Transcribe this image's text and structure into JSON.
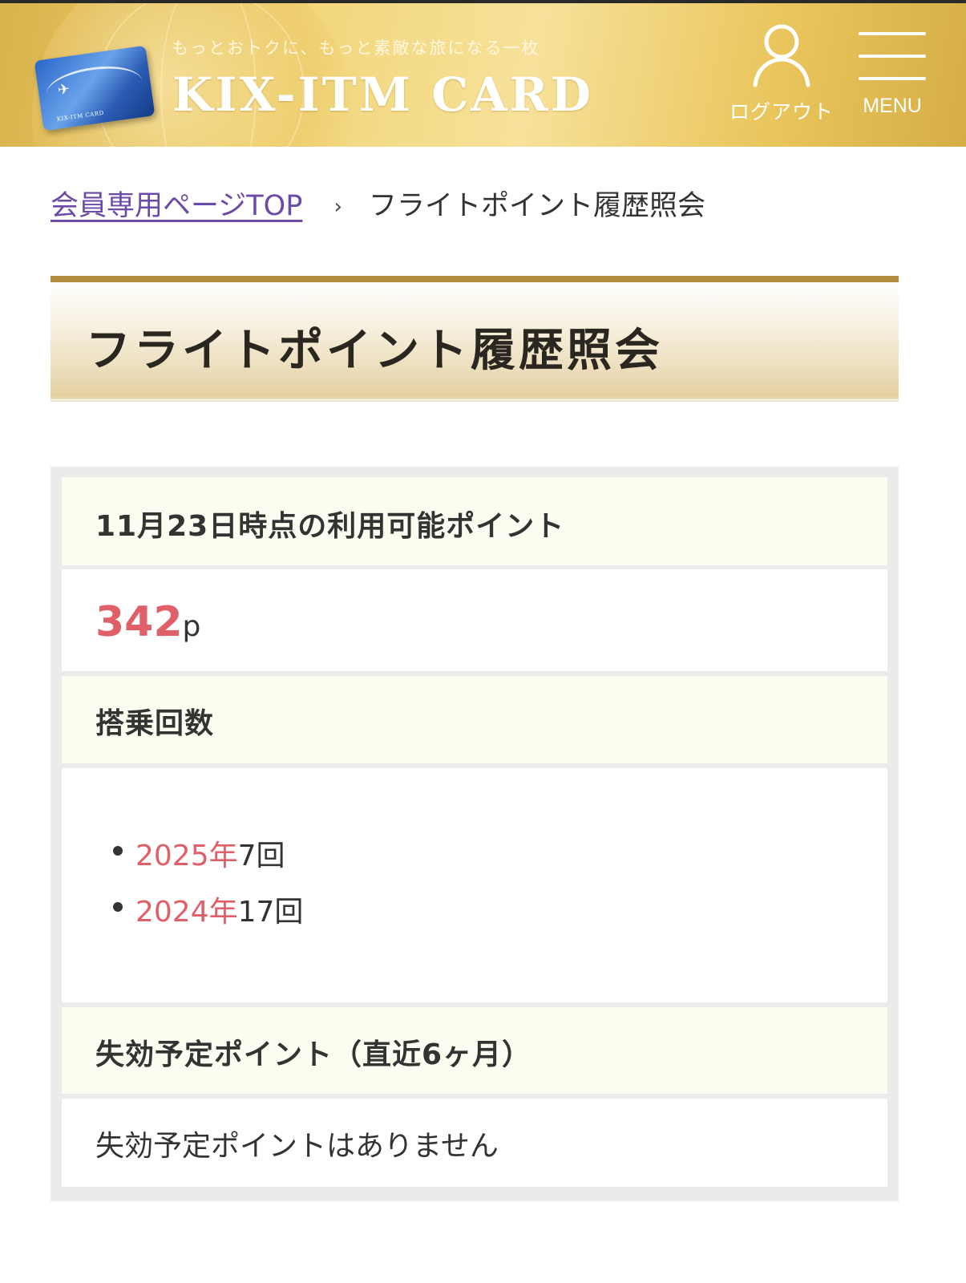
{
  "header": {
    "tagline": "もっとおトクに、もっと素敵な旅になる一枚",
    "brand": "KIX-ITM CARD",
    "card_text": "KIX-ITM CARD",
    "logout_label": "ログアウト",
    "logout_icon": "user-icon",
    "menu_label": "MENU",
    "menu_icon": "hamburger-icon",
    "brand_color": "#e2bf5c"
  },
  "breadcrumb": {
    "link": "会員専用ページTOP",
    "separator": "›",
    "current": "フライトポイント履歴照会"
  },
  "page_title": "フライトポイント履歴照会",
  "points": {
    "heading": "11月23日時点の利用可能ポイント",
    "value": "342",
    "unit": "p",
    "accent_color": "#e0606a"
  },
  "rides": {
    "heading": "搭乗回数",
    "items": [
      {
        "year": "2025年",
        "count": "7回"
      },
      {
        "year": "2024年",
        "count": "17回"
      }
    ]
  },
  "expiring": {
    "heading": "失効予定ポイント（直近6ヶ月）",
    "message": "失効予定ポイントはありません"
  }
}
